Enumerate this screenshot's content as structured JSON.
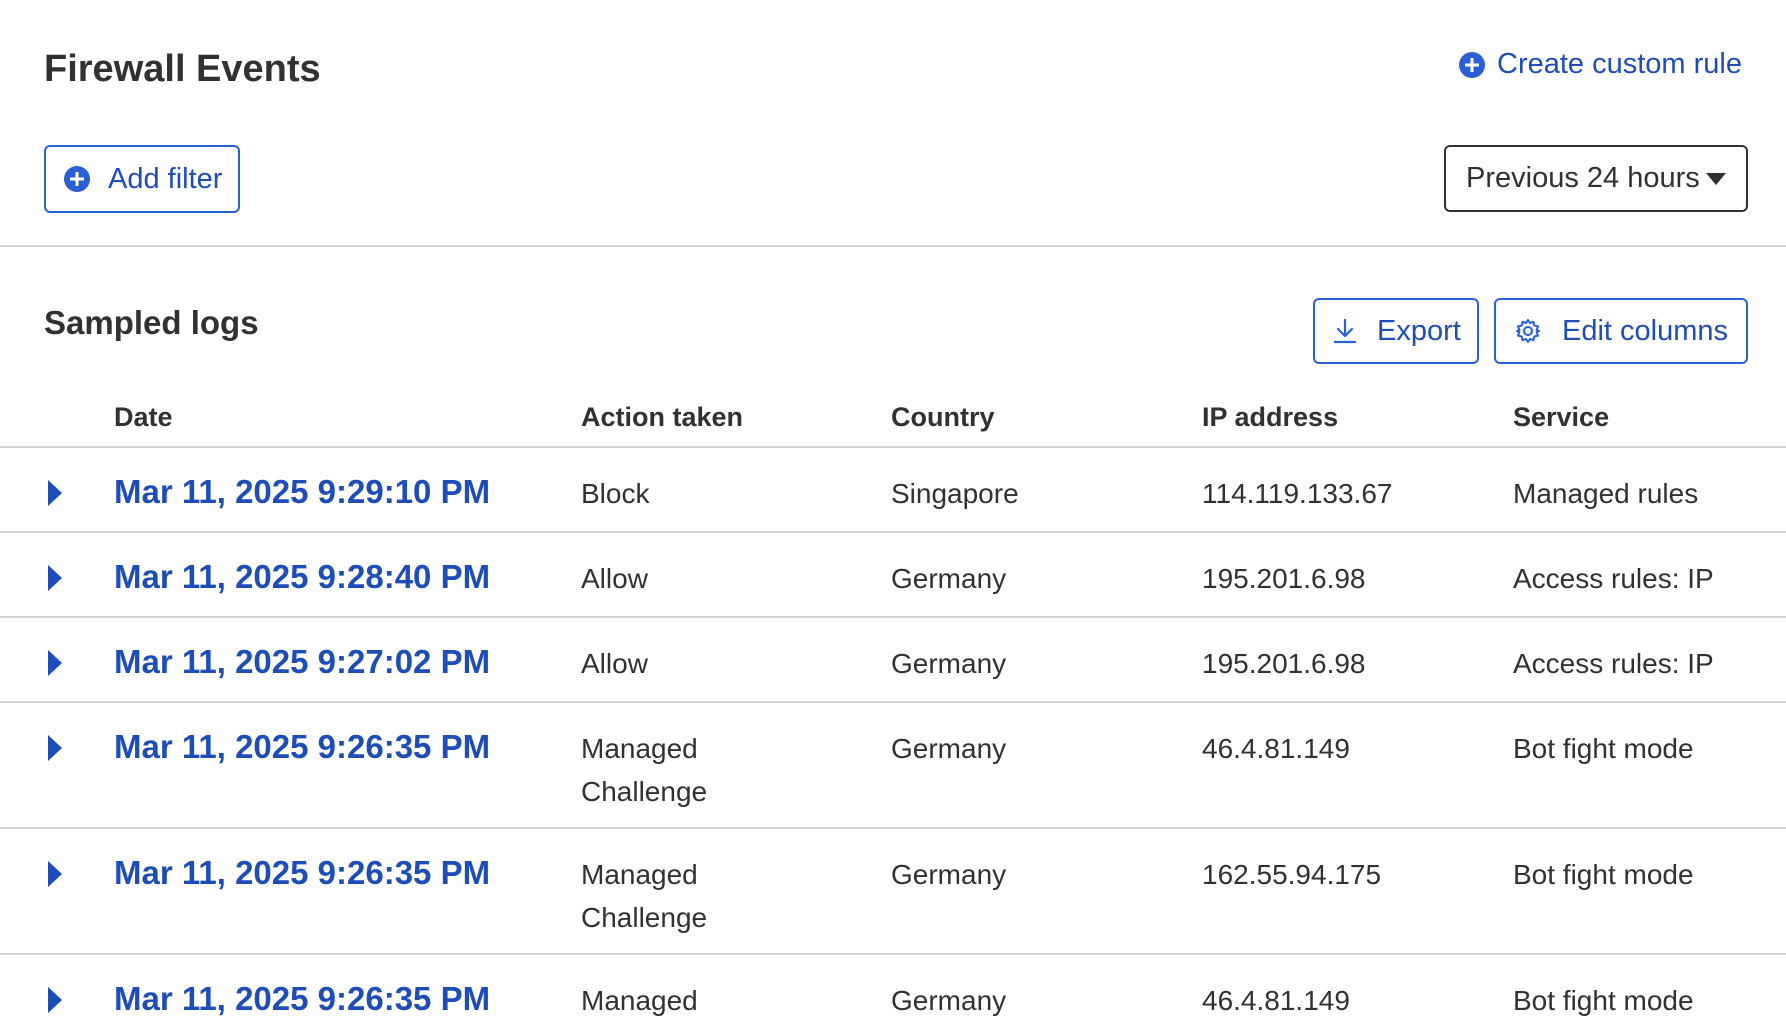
{
  "header": {
    "title": "Firewall Events",
    "create_rule_label": "Create custom rule"
  },
  "filters": {
    "add_filter_label": "Add filter",
    "time_range": "Previous 24 hours"
  },
  "logs": {
    "title": "Sampled logs",
    "export_label": "Export",
    "edit_columns_label": "Edit columns",
    "columns": {
      "date": "Date",
      "action": "Action taken",
      "country": "Country",
      "ip": "IP address",
      "service": "Service"
    },
    "rows": [
      {
        "date": "Mar 11, 2025 9:29:10 PM",
        "action": "Block",
        "country": "Singapore",
        "ip": "114.119.133.67",
        "service": "Managed rules"
      },
      {
        "date": "Mar 11, 2025 9:28:40 PM",
        "action": "Allow",
        "country": "Germany",
        "ip": "195.201.6.98",
        "service": "Access rules: IP"
      },
      {
        "date": "Mar 11, 2025 9:27:02 PM",
        "action": "Allow",
        "country": "Germany",
        "ip": "195.201.6.98",
        "service": "Access rules: IP"
      },
      {
        "date": "Mar 11, 2025 9:26:35 PM",
        "action_line1": "Managed",
        "action_line2": "Challenge",
        "country": "Germany",
        "ip": "46.4.81.149",
        "service": "Bot fight mode"
      },
      {
        "date": "Mar 11, 2025 9:26:35 PM",
        "action_line1": "Managed",
        "action_line2": "Challenge",
        "country": "Germany",
        "ip": "162.55.94.175",
        "service": "Bot fight mode"
      },
      {
        "date": "Mar 11, 2025 9:26:35 PM",
        "action_line1": "Managed",
        "country": "Germany",
        "ip": "46.4.81.149",
        "service": "Bot fight mode"
      }
    ]
  },
  "icons": {
    "create_rule": "plus-circle-icon",
    "add_filter": "plus-circle-icon",
    "time_range": "chevron-down-icon",
    "export": "download-icon",
    "edit_columns": "gear-icon",
    "row_expand": "chevron-right-icon"
  },
  "colors": {
    "accent": "#2b5fd6",
    "link": "#1e4db7",
    "text": "#313131",
    "divider": "#d5d5d5"
  }
}
